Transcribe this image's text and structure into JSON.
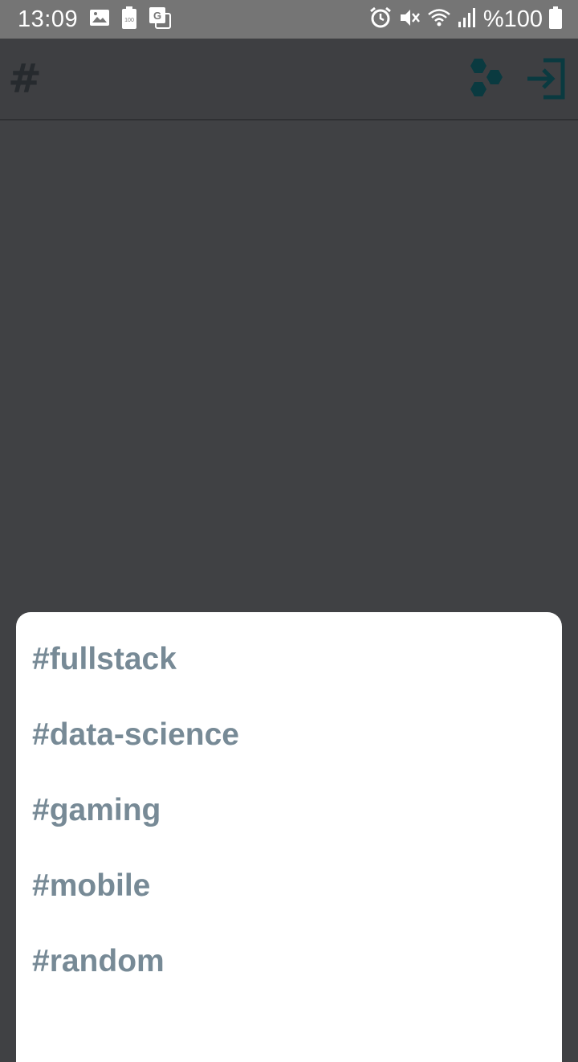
{
  "status_bar": {
    "time": "13:09",
    "battery_text": "%100",
    "left_icons": [
      "image-icon",
      "battery-saver-icon",
      "translate-icon"
    ],
    "right_icons": [
      "alarm-icon",
      "mute-icon",
      "wifi-icon",
      "signal-icon",
      "battery-icon"
    ]
  },
  "toolbar": {
    "title": "#",
    "actions": [
      "hive-icon",
      "login-icon"
    ]
  },
  "colors": {
    "status_bar_bg": "#757575",
    "toolbar_bg": "#3e3f42",
    "content_bg": "#404144",
    "title_color": "#262a2e",
    "accent_icon": "#0a3a40",
    "channel_text": "#778a96",
    "sheet_bg": "#ffffff"
  },
  "channels": [
    {
      "label": "#fullstack"
    },
    {
      "label": "#data-science"
    },
    {
      "label": "#gaming"
    },
    {
      "label": "#mobile"
    },
    {
      "label": "#random"
    }
  ]
}
